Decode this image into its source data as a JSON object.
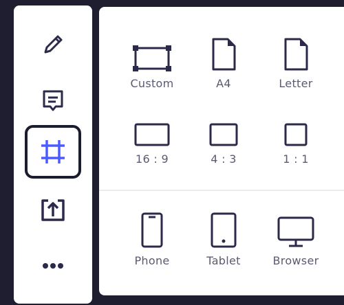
{
  "toolbar": {
    "tools": [
      {
        "icon": "pencil-icon"
      },
      {
        "icon": "comment-icon"
      },
      {
        "icon": "frame-icon",
        "active": true
      },
      {
        "icon": "upload-icon"
      },
      {
        "icon": "more-icon"
      }
    ]
  },
  "frames_panel": {
    "page_sizes": [
      {
        "label": "Custom",
        "icon": "custom-frame-icon"
      },
      {
        "label": "A4",
        "icon": "document-icon"
      },
      {
        "label": "Letter",
        "icon": "document-icon"
      }
    ],
    "ratios": [
      {
        "label": "16 : 9",
        "icon": "wide-rect-icon"
      },
      {
        "label": "4 : 3",
        "icon": "rect-icon"
      },
      {
        "label": "1 : 1",
        "icon": "square-icon"
      }
    ],
    "devices": [
      {
        "label": "Phone",
        "icon": "phone-icon"
      },
      {
        "label": "Tablet",
        "icon": "tablet-icon"
      },
      {
        "label": "Browser",
        "icon": "monitor-icon"
      }
    ]
  },
  "colors": {
    "icon": "#2b2a4a",
    "active_icon": "#4b5cff",
    "background": "#1e1e30"
  }
}
